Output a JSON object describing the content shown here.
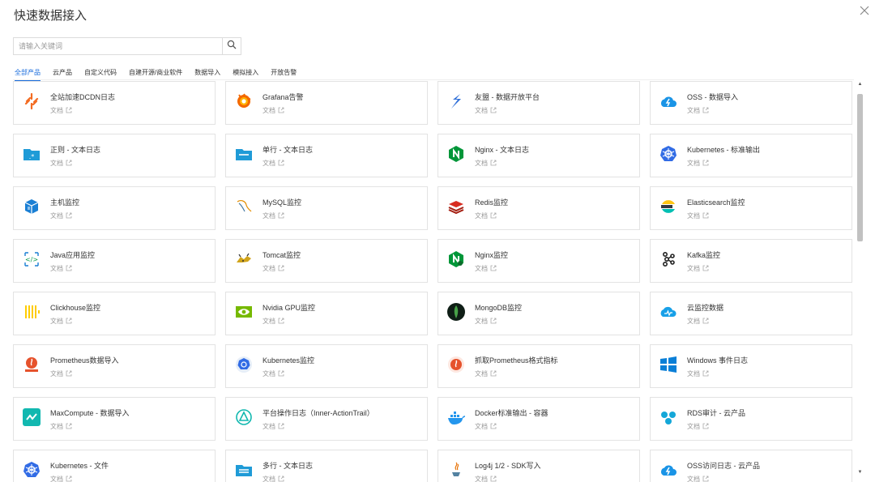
{
  "dialog": {
    "title": "快速数据接入"
  },
  "search": {
    "placeholder": "请输入关键词"
  },
  "tabs": [
    {
      "label": "全部产品",
      "active": true
    },
    {
      "label": "云产品"
    },
    {
      "label": "自定义代码"
    },
    {
      "label": "自建开源/商业软件"
    },
    {
      "label": "数据导入"
    },
    {
      "label": "模拟接入"
    },
    {
      "label": "开放告警"
    }
  ],
  "doc_label": "文档",
  "cards": [
    {
      "name": "全站加速DCDN日志",
      "icon": "dcdn-icon"
    },
    {
      "name": "Grafana告警",
      "icon": "grafana-icon"
    },
    {
      "name": "友盟 - 数据开放平台",
      "icon": "umeng-icon"
    },
    {
      "name": "OSS - 数据导入",
      "icon": "oss-icon"
    },
    {
      "name": "正则 - 文本日志",
      "icon": "regex-folder-icon"
    },
    {
      "name": "单行 - 文本日志",
      "icon": "single-line-folder-icon"
    },
    {
      "name": "Nginx - 文本日志",
      "icon": "nginx-icon"
    },
    {
      "name": "Kubernetes - 标准输出",
      "icon": "kubernetes-icon"
    },
    {
      "name": "主机监控",
      "icon": "host-icon"
    },
    {
      "name": "MySQL监控",
      "icon": "mysql-icon"
    },
    {
      "name": "Redis监控",
      "icon": "redis-icon"
    },
    {
      "name": "Elasticsearch监控",
      "icon": "elasticsearch-icon"
    },
    {
      "name": "Java应用监控",
      "icon": "java-icon"
    },
    {
      "name": "Tomcat监控",
      "icon": "tomcat-icon"
    },
    {
      "name": "Nginx监控",
      "icon": "nginx-monitor-icon"
    },
    {
      "name": "Kafka监控",
      "icon": "kafka-icon"
    },
    {
      "name": "Clickhouse监控",
      "icon": "clickhouse-icon"
    },
    {
      "name": "Nvidia GPU监控",
      "icon": "nvidia-icon"
    },
    {
      "name": "MongoDB监控",
      "icon": "mongodb-icon"
    },
    {
      "name": "云监控数据",
      "icon": "cloud-monitor-icon"
    },
    {
      "name": "Prometheus数据导入",
      "icon": "prometheus-import-icon"
    },
    {
      "name": "Kubernetes监控",
      "icon": "kubernetes-monitor-icon"
    },
    {
      "name": "抓取Prometheus格式指标",
      "icon": "prometheus-icon"
    },
    {
      "name": "Windows 事件日志",
      "icon": "windows-icon"
    },
    {
      "name": "MaxCompute - 数据导入",
      "icon": "maxcompute-icon"
    },
    {
      "name": "平台操作日志（Inner-ActionTrail）",
      "icon": "actiontrail-icon"
    },
    {
      "name": "Docker标准输出 - 容器",
      "icon": "docker-icon"
    },
    {
      "name": "RDS审计 - 云产品",
      "icon": "rds-icon"
    },
    {
      "name": "Kubernetes - 文件",
      "icon": "kubernetes-icon"
    },
    {
      "name": "多行 - 文本日志",
      "icon": "multi-line-folder-icon"
    },
    {
      "name": "Log4j 1/2 - SDK写入",
      "icon": "java-cup-icon"
    },
    {
      "name": "OSS访问日志 - 云产品",
      "icon": "oss-icon"
    }
  ],
  "colors": {
    "accent": "#1b6ddc",
    "border": "#e3e3e3",
    "muted": "#999999"
  }
}
